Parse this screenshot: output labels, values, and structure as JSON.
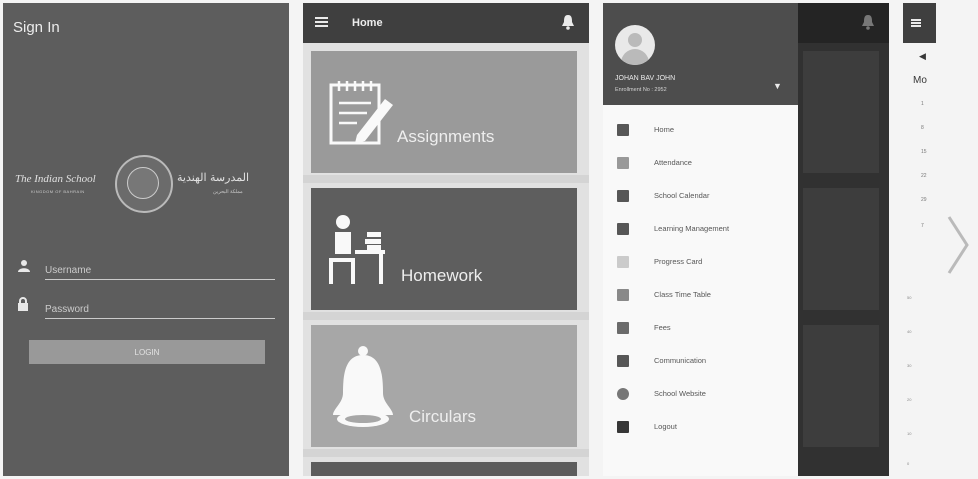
{
  "signin": {
    "title": "Sign In",
    "logo_en": "The Indian School",
    "logo_en_sub": "KINGDOM OF BAHRAIN",
    "logo_ar": "المدرسة الهندية",
    "logo_ar_sub": "مملكة البحرين",
    "username_placeholder": "Username",
    "password_placeholder": "Password",
    "login_label": "LOGIN"
  },
  "home": {
    "title": "Home",
    "cards": [
      {
        "label": "Assignments",
        "icon": "assignment-icon"
      },
      {
        "label": "Homework",
        "icon": "homework-icon"
      },
      {
        "label": "Circulars",
        "icon": "bell-icon"
      }
    ]
  },
  "drawer": {
    "user_name": "JOHAN BAV JOHN",
    "enrollment": "Enrollment No : 2952",
    "items": [
      {
        "label": "Home",
        "icon": "home-icon"
      },
      {
        "label": "Attendance",
        "icon": "attendance-icon"
      },
      {
        "label": "School Calendar",
        "icon": "calendar-icon"
      },
      {
        "label": "Learning Management",
        "icon": "learning-icon"
      },
      {
        "label": "Progress Card",
        "icon": "progress-card-icon"
      },
      {
        "label": "Class Time Table",
        "icon": "timetable-icon"
      },
      {
        "label": "Fees",
        "icon": "fees-icon"
      },
      {
        "label": "Communication",
        "icon": "communication-icon"
      },
      {
        "label": "School Website",
        "icon": "website-icon"
      },
      {
        "label": "Logout",
        "icon": "logout-icon"
      }
    ]
  },
  "partial": {
    "month_prefix": "Mo",
    "day_numbers": [
      "1",
      "8",
      "15",
      "22",
      "29",
      "7"
    ],
    "axis_values": [
      "50",
      "40",
      "30",
      "20",
      "10",
      "0"
    ]
  }
}
